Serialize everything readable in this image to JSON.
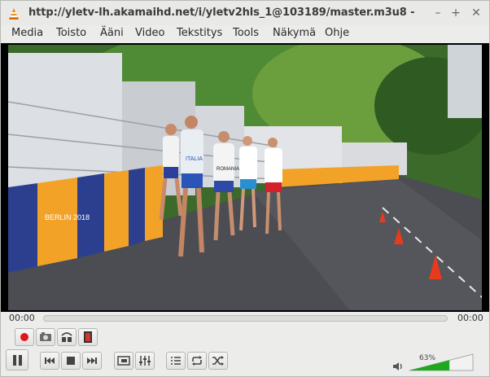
{
  "window": {
    "title": "http://yletv-lh.akamaihd.net/i/yletv2hls_1@103189/master.m3u8 - VLC"
  },
  "window_controls": {
    "minimize": "–",
    "maximize": "+",
    "close": "✕"
  },
  "menu": [
    "Media",
    "Toisto",
    "Ääni",
    "Video",
    "Tekstitys",
    "Tools",
    "Näkymä",
    "Ohje"
  ],
  "player": {
    "elapsed": "00:00",
    "remaining": "00:00",
    "volume_label": "63%",
    "volume": 0.63,
    "progress": 0.0
  },
  "video": {
    "banner_text": "BERLIN 2018",
    "bib_1": "ITALIA",
    "bib_2": "ROMANIA"
  },
  "colors": {
    "record": "#e0161b",
    "volume_fill": "#1fa81f",
    "banner_blue": "#2c3f8f",
    "banner_orange": "#f3a228"
  }
}
